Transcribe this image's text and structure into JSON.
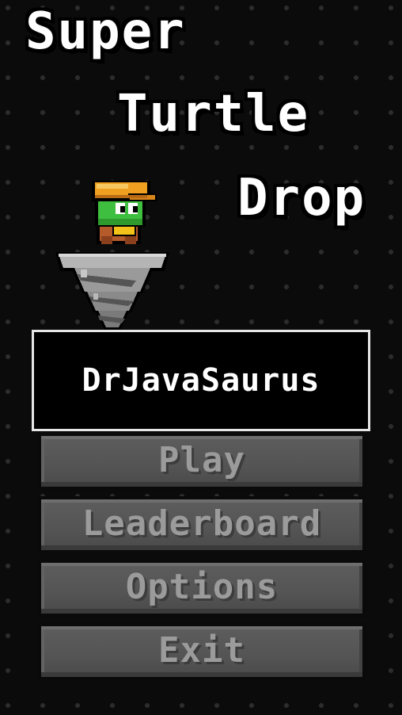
{
  "title": {
    "line1": "Super",
    "line2": "Turtle",
    "line3": "Drop"
  },
  "player": {
    "name": "DrJavaSaurus"
  },
  "menu": {
    "play": "Play",
    "leaderboard": "Leaderboard",
    "options": "Options",
    "exit": "Exit"
  },
  "colors": {
    "background": "#181818",
    "title_text": "#ffffff",
    "name_box_border": "#e6e6e6",
    "button_face": "#545454",
    "button_label": "#9b9b9b",
    "turtle_green": "#3fbf3f",
    "helmet_orange": "#f0a020",
    "drill_gray": "#9a9a9a"
  }
}
